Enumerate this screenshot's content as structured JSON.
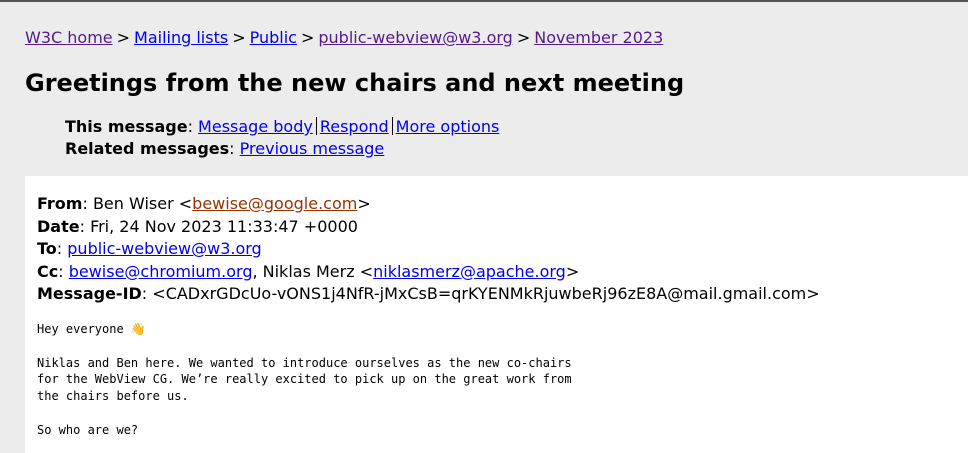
{
  "breadcrumb": {
    "items": [
      "W3C home",
      "Mailing lists",
      "Public",
      "public-webview@w3.org",
      "November 2023"
    ],
    "separator": ">"
  },
  "title": "Greetings from the new chairs and next meeting",
  "nav": {
    "this_message_label": "This message",
    "message_body": "Message body",
    "respond": "Respond",
    "more_options": "More options",
    "related_messages_label": "Related messages",
    "previous_message": "Previous message"
  },
  "headers": {
    "from_label": "From",
    "from_name": "Ben Wiser <",
    "from_email": "bewise@google.com",
    "from_close": ">",
    "date_label": "Date",
    "date_value": "Fri, 24 Nov 2023 11:33:47 +0000",
    "to_label": "To",
    "to_email": "public-webview@w3.org",
    "cc_label": "Cc",
    "cc_email1": "bewise@chromium.org",
    "cc_name2": ", Niklas Merz <",
    "cc_email2": "niklasmerz@apache.org",
    "cc_close": ">",
    "message_id_label": "Message-ID",
    "message_id_value": "<CADxrGDcUo-vONS1j4NfR-jMxCsB=qrKYENMkRjuwbeRj96zE8A@mail.gmail.com>"
  },
  "body_text": "Hey everyone 👋\n\nNiklas and Ben here. We wanted to introduce ourselves as the new co-chairs\nfor the WebView CG. We’re really excited to pick up on the great work from\nthe chairs before us.\n\nSo who are we?",
  "colors": {
    "page_background": "#ececec",
    "panel_background": "#ffffff",
    "link": "#0000ee",
    "visited_link": "#551a8b",
    "active_link": "#993300"
  }
}
